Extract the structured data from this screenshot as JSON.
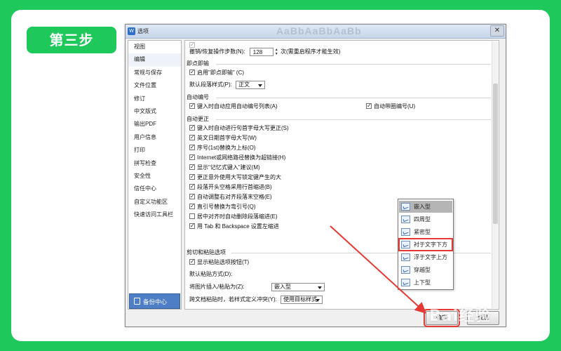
{
  "step_badge": "第三步",
  "dialog": {
    "title": "选项",
    "title_blur": "AaBbAaBbAaBb",
    "close": "✕"
  },
  "nav": {
    "items": [
      "视图",
      "编辑",
      "常规与保存",
      "文件位置",
      "修订",
      "中文版式",
      "输出PDF",
      "用户信息",
      "打印",
      "拼写检查",
      "安全性",
      "信任中心",
      "自定义功能区",
      "快速访问工具栏"
    ],
    "selected_index": 1,
    "backup_label": "备份中心"
  },
  "panel": {
    "undo_label": "撤销/恢复操作步数(N):",
    "undo_value": "128",
    "undo_note": "次(需重启程序才能生效)",
    "instant_section": "即点即输",
    "enable_instant": "启用\"即点即输\" (C)",
    "default_para_label": "默认段落样式(P):",
    "default_para_value": "正文",
    "autonum_section": "自动编号",
    "auto_numbered_list": "键入时自动应用自动编号列表(A)",
    "auto_circle_num": "自动带圈编号(U)",
    "autocorrect_section": "自动更正",
    "ac_items": [
      "键入时自动进行句首字母大写更正(S)",
      "英文日期首字母大写(W)",
      "序号(1st)替换为上标(O)",
      "Internet或网络路径替换为超链接(H)",
      "显示\"记忆式键入\"建议(M)",
      "更正意外使用大写锁定键产生的大",
      "段落开头空格采用行首缩进(B)",
      "自动调整右对齐段落末空格(E)",
      "直引号替换为弯引号(Q)",
      "居中对齐时自动删除段落缩进(E)",
      "用 Tab 和 Backspace 设置左缩进"
    ],
    "ac_checked": [
      true,
      true,
      true,
      true,
      true,
      true,
      true,
      true,
      true,
      false,
      true
    ],
    "cutpaste_section": "剪切和粘贴选项",
    "show_paste_btn": "显示粘贴选项按钮(T)",
    "default_paste_label": "默认粘贴方式(D):",
    "insert_pic_label": "将图片插入/粘贴为(Z):",
    "insert_pic_value": "嵌入型",
    "cross_doc_label": "跨文档粘贴时，若样式定义冲突(Y):",
    "cross_doc_value": "使用目标样式"
  },
  "dropdown": {
    "items": [
      "嵌入型",
      "四周型",
      "紧密型",
      "衬于文字下方",
      "浮于文字上方",
      "穿越型",
      "上下型"
    ],
    "active_index": 0,
    "highlight_index": 3
  },
  "buttons": {
    "ok": "确定",
    "cancel": "取消"
  },
  "watermark": "Bai经验"
}
